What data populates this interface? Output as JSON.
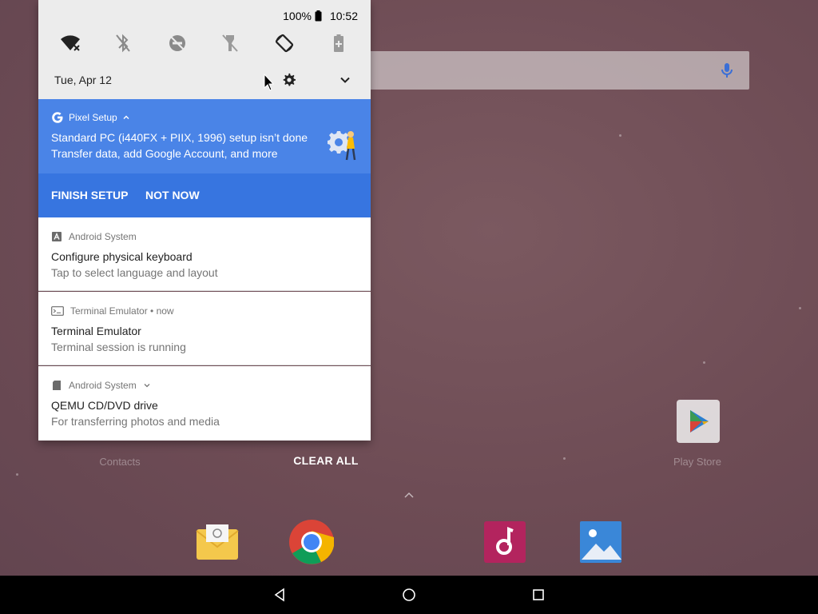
{
  "status_bar": {
    "battery": "100%",
    "time": "10:52"
  },
  "quick_settings": {
    "date": "Tue, Apr 12",
    "tiles": [
      "wifi-off-icon",
      "bluetooth-off-icon",
      "do-not-disturb-off-icon",
      "flashlight-off-icon",
      "auto-rotate-icon",
      "battery-saver-icon"
    ]
  },
  "pixel_setup": {
    "app_name": "Pixel Setup",
    "title": "Standard PC (i440FX + PIIX, 1996) setup isn’t done",
    "text": "Transfer data, add Google Account, and more",
    "action_finish": "FINISH SETUP",
    "action_not_now": "NOT NOW",
    "color": "#4a84e7"
  },
  "notifications": [
    {
      "app": "Android System",
      "title": "Configure physical keyboard",
      "text": "Tap to select language and layout"
    },
    {
      "app": "Terminal Emulator • now",
      "title": "Terminal Emulator",
      "text": "Terminal session is running"
    },
    {
      "app": "Android System",
      "title": "QEMU CD/DVD drive",
      "text": "For transferring photos and media"
    }
  ],
  "home": {
    "clear_all": "CLEAR ALL",
    "contacts_label": "Contacts",
    "playstore_label": "Play Store",
    "dock": [
      "email-app-icon",
      "chrome-app-icon",
      "music-app-icon",
      "gallery-app-icon"
    ]
  },
  "nav_bar": {
    "buttons": [
      "back-icon",
      "home-icon",
      "recents-icon"
    ]
  }
}
